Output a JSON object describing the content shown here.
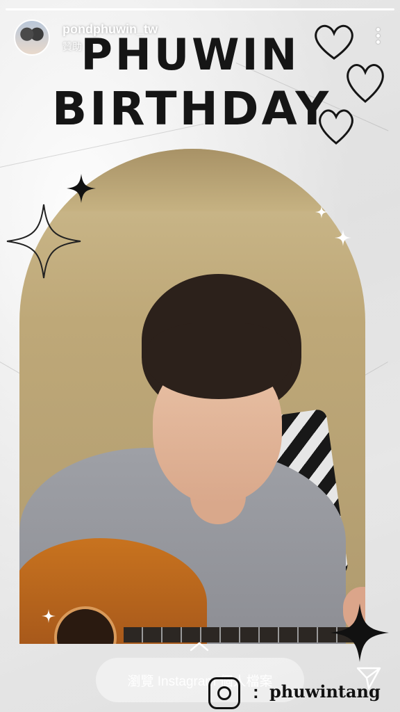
{
  "story": {
    "progress": 1.0
  },
  "header": {
    "username": "pondphuwin_tw",
    "sponsored_label": "贊助"
  },
  "graphic": {
    "title_line1": "PHUWIN",
    "title_line2": "BIRTHDAY",
    "handle": "phuwintang",
    "handle_separator": ":"
  },
  "footer": {
    "profile_button_label": "瀏覽 Instagram 個人檔案"
  },
  "icons": {
    "more": "more-vertical-icon",
    "chevron": "chevron-up-icon",
    "send": "send-icon",
    "instagram": "instagram-icon"
  },
  "colors": {
    "title_ink": "#151515",
    "text_white": "#ffffff"
  }
}
